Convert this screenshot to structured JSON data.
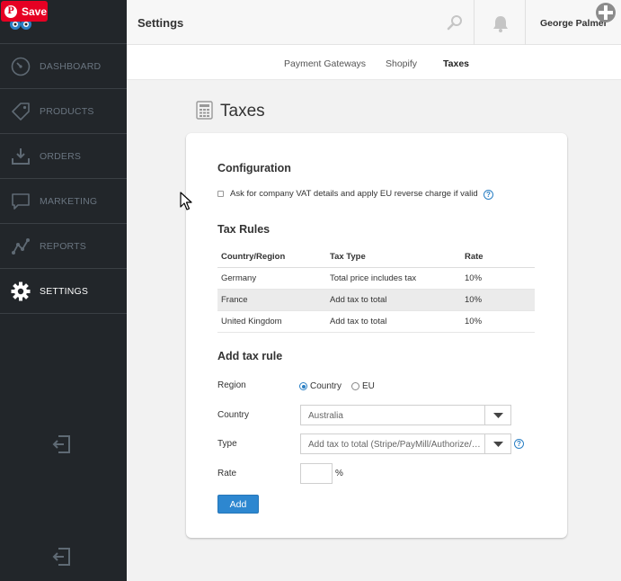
{
  "pinterest": {
    "save_label": "Save",
    "logo_glyph": "P"
  },
  "sidebar": {
    "items": [
      {
        "label": "DASHBOARD",
        "icon": "gauge-icon"
      },
      {
        "label": "PRODUCTS",
        "icon": "tag-icon"
      },
      {
        "label": "ORDERS",
        "icon": "download-tray-icon"
      },
      {
        "label": "MARKETING",
        "icon": "speech-bubble-icon"
      },
      {
        "label": "REPORTS",
        "icon": "line-graph-icon"
      },
      {
        "label": "SETTINGS",
        "icon": "gear-icon",
        "active": true
      }
    ],
    "logout_icons": [
      "logout-icon",
      "logout-icon"
    ]
  },
  "header": {
    "title": "Settings",
    "user_name": "George Palmer"
  },
  "tabs": [
    {
      "label": "Payment Gateways"
    },
    {
      "label": "Shopify"
    },
    {
      "label": "Taxes",
      "active": true
    }
  ],
  "page": {
    "title": "Taxes"
  },
  "configuration": {
    "title": "Configuration",
    "checkbox_label": "Ask for company VAT details and apply EU reverse charge if valid",
    "checked": false,
    "help_glyph": "?"
  },
  "tax_rules": {
    "title": "Tax Rules",
    "columns": [
      "Country/Region",
      "Tax Type",
      "Rate"
    ],
    "rows": [
      [
        "Germany",
        "Total price includes tax",
        "10%"
      ],
      [
        "France",
        "Add tax to total",
        "10%"
      ],
      [
        "United Kingdom",
        "Add tax to total",
        "10%"
      ]
    ]
  },
  "add_rule": {
    "title": "Add tax rule",
    "region_label": "Region",
    "region_options": [
      "Country",
      "EU"
    ],
    "region_selected": "Country",
    "country_label": "Country",
    "country_value": "Australia",
    "type_label": "Type",
    "type_value": "Add tax to total (Stripe/PayMill/Authorize/Sa...",
    "rate_label": "Rate",
    "rate_value": "",
    "rate_unit": "%",
    "help_glyph": "?",
    "submit_label": "Add"
  },
  "colors": {
    "sidebar_bg": "#22262a",
    "accent": "#2d87d0",
    "pinterest_red": "#e60023"
  }
}
